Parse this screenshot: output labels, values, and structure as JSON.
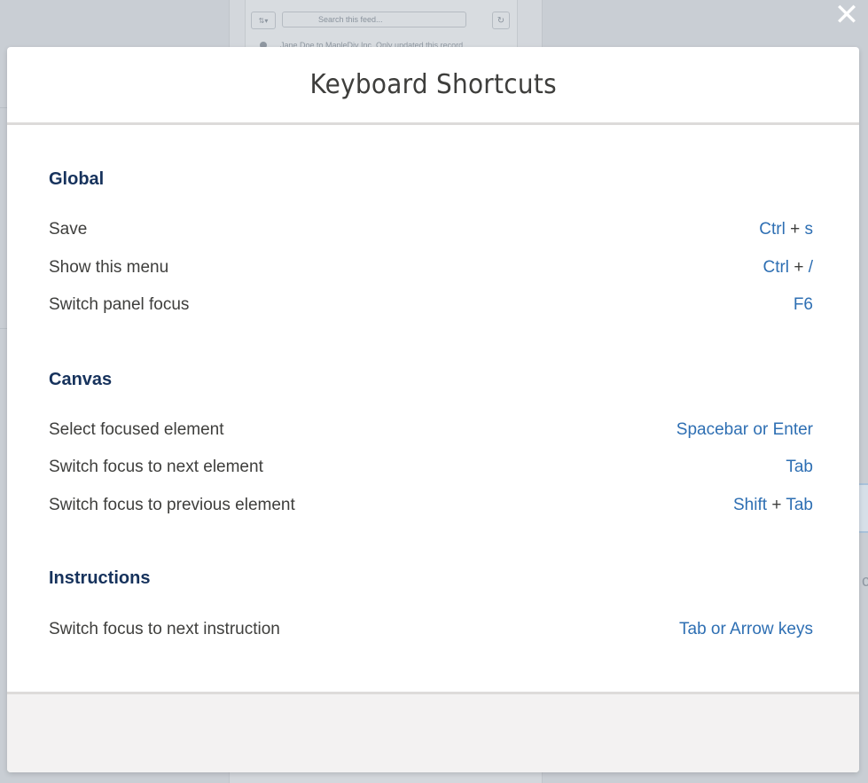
{
  "background": {
    "feed_search_placeholder": "Search this feed...",
    "feed_first_item": "Jane Doe to MapleDiv Inc. Only updated this record"
  },
  "dialog": {
    "title": "Keyboard Shortcuts",
    "close_icon": "close-icon",
    "sections": [
      {
        "title": "Global",
        "rows": [
          {
            "label": "Save",
            "keys": "Ctrl",
            "sep": "+",
            "keys2": "s"
          },
          {
            "label": "Show this menu",
            "keys": "Ctrl",
            "sep": "+",
            "keys2": "/"
          },
          {
            "label": "Switch panel focus",
            "keys": "F6",
            "sep": "",
            "keys2": ""
          }
        ]
      },
      {
        "title": "Canvas",
        "rows": [
          {
            "label": "Select focused element",
            "keys": "Spacebar or Enter",
            "sep": "",
            "keys2": ""
          },
          {
            "label": "Switch focus to next element",
            "keys": "Tab",
            "sep": "",
            "keys2": ""
          },
          {
            "label": "Switch focus to previous element",
            "keys": "Shift",
            "sep": "+",
            "keys2": "Tab"
          }
        ]
      },
      {
        "title": "Instructions",
        "rows": [
          {
            "label": "Switch focus to next instruction",
            "keys": "Tab or Arrow keys",
            "sep": "",
            "keys2": ""
          }
        ]
      }
    ]
  },
  "colors": {
    "accent_link": "#2e6fb3",
    "heading": "#16325c",
    "text": "#3e3e3c",
    "overlay": "#b8bfc7"
  }
}
